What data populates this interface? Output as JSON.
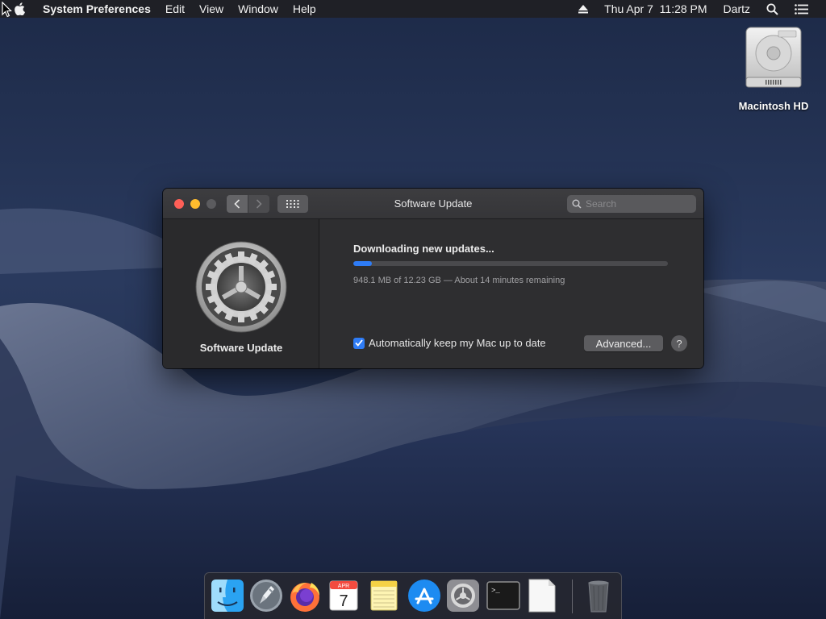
{
  "menubar": {
    "app_name": "System Preferences",
    "items": [
      "Edit",
      "View",
      "Window",
      "Help"
    ],
    "clock": "Thu Apr 7  11:28 PM",
    "user": "Dartz",
    "icons": [
      "apple-icon",
      "eject-icon",
      "spotlight-icon",
      "notification-center-icon"
    ]
  },
  "desktop": {
    "disk_label": "Macintosh HD"
  },
  "window": {
    "title": "Software Update",
    "search_placeholder": "Search",
    "pane_title": "Software Update",
    "status_title": "Downloading new updates...",
    "progress_fraction": 0.06,
    "progress_detail": "948.1 MB of 12.23 GB — About 14 minutes remaining",
    "auto_update_label": "Automatically keep my Mac up to date",
    "auto_update_checked": true,
    "advanced_label": "Advanced...",
    "help_label": "?"
  },
  "dock": {
    "items": [
      "Finder",
      "Launchpad",
      "Firefox",
      "Calendar",
      "Notes",
      "App Store",
      "System Preferences",
      "Terminal",
      "TextEdit",
      "Trash"
    ],
    "calendar_month": "APR",
    "calendar_day": "7",
    "terminal_prompt": ">_"
  },
  "colors": {
    "accent": "#2e7cf6",
    "close": "#fe5f57",
    "minimize": "#febc2e",
    "window_bg": "#2c2c2e"
  }
}
